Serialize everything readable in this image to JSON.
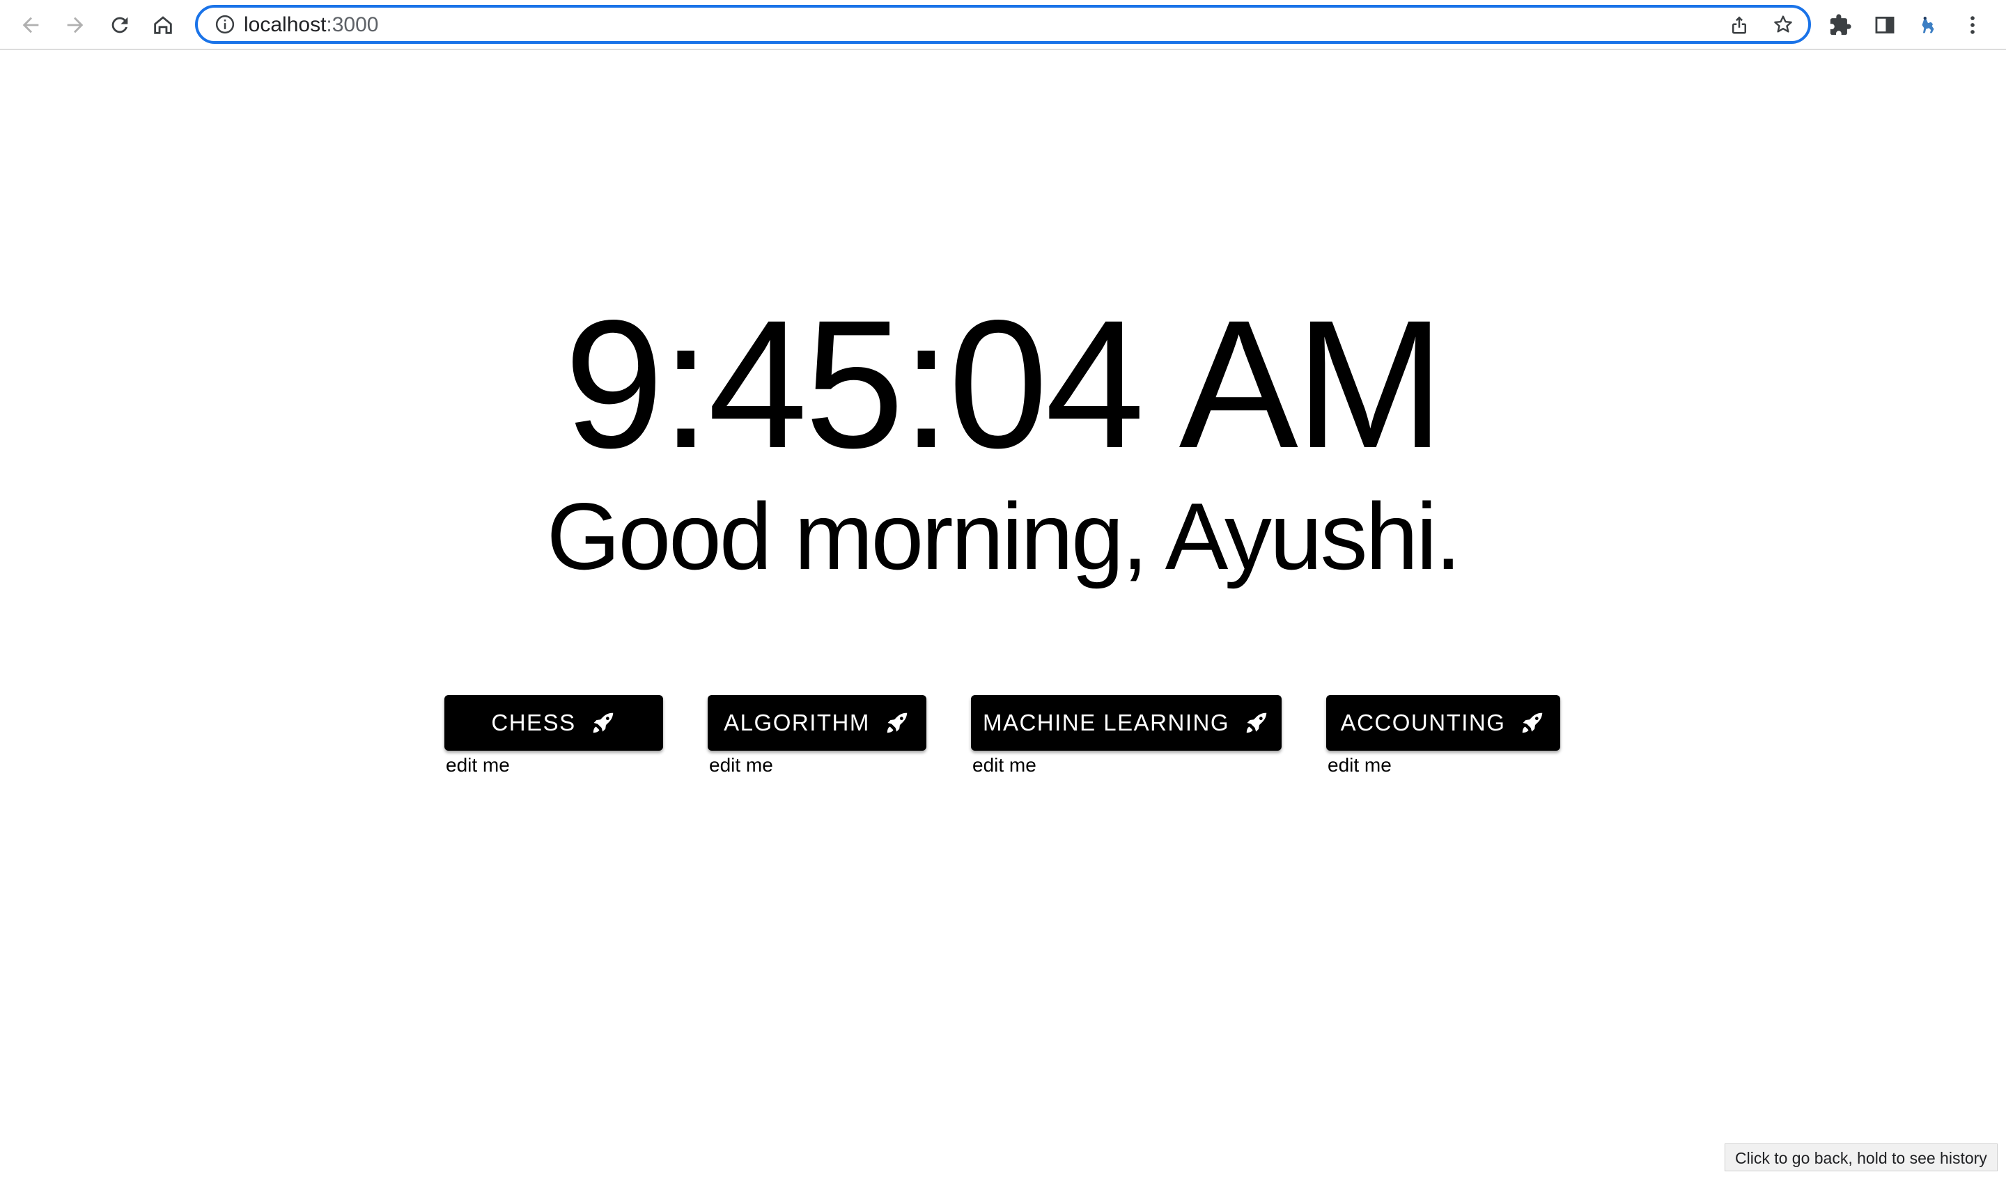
{
  "browser": {
    "url_host": "localhost",
    "url_port": ":3000",
    "icons": {
      "back": "arrow-left-icon",
      "forward": "arrow-right-icon",
      "reload": "reload-icon",
      "home": "home-icon",
      "info": "info-icon",
      "share": "share-icon",
      "bookmark": "star-icon",
      "extensions": "puzzle-icon",
      "side_panel": "side-panel-icon",
      "profile": "profile-avatar-icon",
      "menu": "kebab-menu-icon"
    },
    "accent_color": "#1a73e8"
  },
  "page": {
    "clock": "9:45:04 AM",
    "greeting": "Good morning, Ayushi.",
    "topics": [
      {
        "label": "CHESS",
        "edit_label": "edit me"
      },
      {
        "label": "ALGORITHM",
        "edit_label": "edit me"
      },
      {
        "label": "MACHINE LEARNING",
        "edit_label": "edit me"
      },
      {
        "label": "ACCOUNTING",
        "edit_label": "edit me"
      }
    ],
    "button_icon": "rocket-icon"
  },
  "tooltip": {
    "text": "Click to go back, hold to see history"
  }
}
